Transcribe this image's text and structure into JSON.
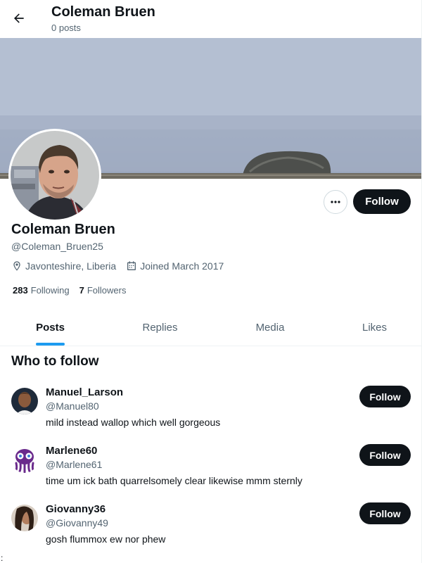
{
  "header": {
    "title": "Coleman Bruen",
    "subtitle": "0 posts"
  },
  "profile": {
    "name": "Coleman Bruen",
    "handle": "@Coleman_Bruen25",
    "location": "Javonteshire, Liberia",
    "joined": "Joined March 2017",
    "following_count": "283",
    "following_label": "Following",
    "followers_count": "7",
    "followers_label": "Followers",
    "follow_label": "Follow",
    "more_label": "•••"
  },
  "tabs": [
    {
      "label": "Posts",
      "active": true
    },
    {
      "label": "Replies"
    },
    {
      "label": "Media"
    },
    {
      "label": "Likes"
    }
  ],
  "who_to_follow": {
    "title": "Who to follow",
    "users": [
      {
        "name": "Manuel_Larson",
        "handle": "@Manuel80",
        "bio": "mild instead wallop which well gorgeous",
        "follow_label": "Follow"
      },
      {
        "name": "Marlene60",
        "handle": "@Marlene61",
        "bio": "time um ick bath quarrelsomely clear likewise mmm sternly",
        "follow_label": "Follow"
      },
      {
        "name": "Giovanny36",
        "handle": "@Giovanny49",
        "bio": "gosh flummox ew nor phew",
        "follow_label": "Follow"
      }
    ]
  },
  "footer_mark": ":",
  "colors": {
    "accent": "#1d9bf0",
    "text": "#0f1419",
    "muted": "#536471",
    "button": "#0f1419"
  },
  "icons": [
    "back-arrow-icon",
    "more-icon",
    "location-pin-icon",
    "calendar-icon"
  ]
}
